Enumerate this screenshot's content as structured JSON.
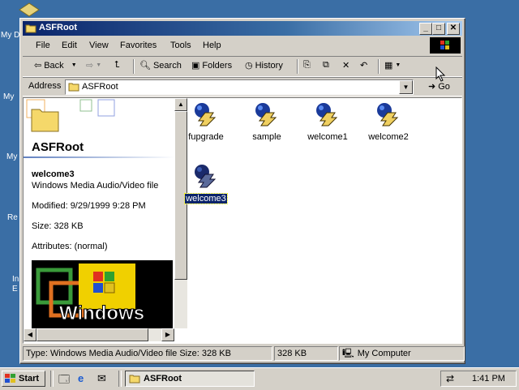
{
  "desktop": {
    "labels": [
      "My D",
      "My",
      "My",
      "Re",
      "In",
      "E"
    ]
  },
  "window": {
    "title": "ASFRoot",
    "controls": {
      "minimize": "_",
      "maximize": "□",
      "close": "✕"
    }
  },
  "menu": [
    "File",
    "Edit",
    "View",
    "Favorites",
    "Tools",
    "Help"
  ],
  "toolbar": {
    "back": "Back",
    "search": "Search",
    "folders": "Folders",
    "history": "History"
  },
  "address": {
    "label": "Address",
    "value": "ASFRoot",
    "go": "Go"
  },
  "details": {
    "folder_title": "ASFRoot",
    "file_name": "welcome3",
    "file_type": "Windows Media Audio/Video file",
    "modified": "Modified: 9/29/1999 9:28 PM",
    "size": "Size: 328 KB",
    "attributes": "Attributes: (normal)",
    "banner_text": "Windows"
  },
  "files": [
    {
      "name": "fupgrade",
      "selected": false
    },
    {
      "name": "sample",
      "selected": false
    },
    {
      "name": "welcome1",
      "selected": false
    },
    {
      "name": "welcome2",
      "selected": false
    },
    {
      "name": "welcome3",
      "selected": true
    }
  ],
  "status": {
    "info": "Type: Windows Media Audio/Video file Size: 328 KB",
    "size": "328 KB",
    "zone": "My Computer"
  },
  "taskbar": {
    "start": "Start",
    "task": "ASFRoot",
    "clock": "1:41 PM"
  },
  "colors": {
    "desktop": "#3a6ea5",
    "title_active": "#0a246a",
    "selection": "#0a246a"
  }
}
